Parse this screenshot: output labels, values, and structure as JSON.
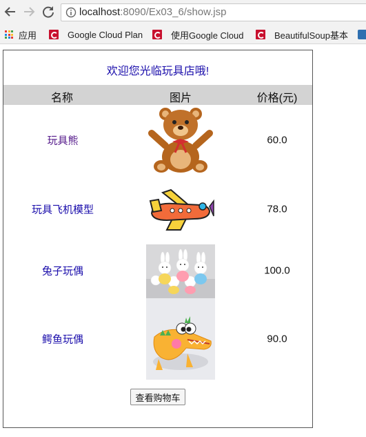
{
  "browser": {
    "url_host": "localhost",
    "url_rest": ":8090/Ex03_6/show.jsp",
    "bookmarks": [
      {
        "label": "应用",
        "icon": "apps-grid-icon"
      },
      {
        "label": "Google Cloud Plan",
        "icon": "red-c-icon"
      },
      {
        "label": "使用Google Cloud",
        "icon": "red-c-icon"
      },
      {
        "label": "BeautifulSoup基本",
        "icon": "red-c-icon"
      }
    ]
  },
  "page": {
    "welcome": "欢迎您光临玩具店哦!",
    "headers": {
      "name": "名称",
      "image": "图片",
      "price": "价格(元)"
    },
    "items": [
      {
        "name": "玩具熊",
        "price": "60.0",
        "image": "teddy-bear"
      },
      {
        "name": "玩具飞机模型",
        "price": "78.0",
        "image": "toy-airplane"
      },
      {
        "name": "兔子玩偶",
        "price": "100.0",
        "image": "bunny-dolls"
      },
      {
        "name": "鳄鱼玩偶",
        "price": "90.0",
        "image": "crocodile-toy"
      }
    ],
    "cart_button": "查看购物车"
  }
}
